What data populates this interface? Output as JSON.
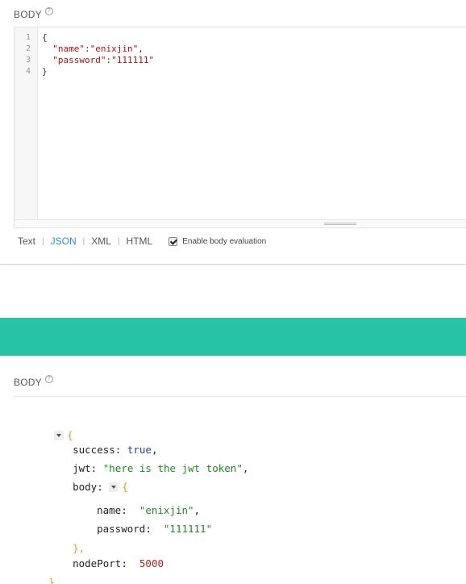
{
  "request": {
    "body_label": "BODY",
    "help_glyph": "?",
    "line_numbers": [
      "1",
      "2",
      "3",
      "4"
    ],
    "code": {
      "open": "{",
      "name_key": "\"name\"",
      "name_sep": ":",
      "name_val": "\"enixjin\"",
      "name_comma": ",",
      "pwd_key": "\"password\"",
      "pwd_sep": ":",
      "pwd_val": "\"111111\"",
      "close": "}"
    },
    "formats": [
      "Text",
      "JSON",
      "XML",
      "HTML"
    ],
    "active_format": "JSON",
    "separator": "|",
    "eval_label": "Enable body evaluation",
    "eval_checked": true
  },
  "banner_color": "#26c4a6",
  "response": {
    "body_label": "BODY",
    "help_glyph": "?",
    "open_brace": "{",
    "close_brace": "}",
    "success_key": "success:",
    "success_val": "true",
    "jwt_key": "jwt:",
    "jwt_val": "\"here is the jwt token\"",
    "body_key": "body:",
    "body_open": "{",
    "body_close": "},",
    "name_key": "name:",
    "name_val": "\"enixjin\"",
    "password_key": "password:",
    "password_val": "\"111111\"",
    "nodeport_key": "nodePort:",
    "nodeport_val": "5000",
    "comma": ","
  }
}
